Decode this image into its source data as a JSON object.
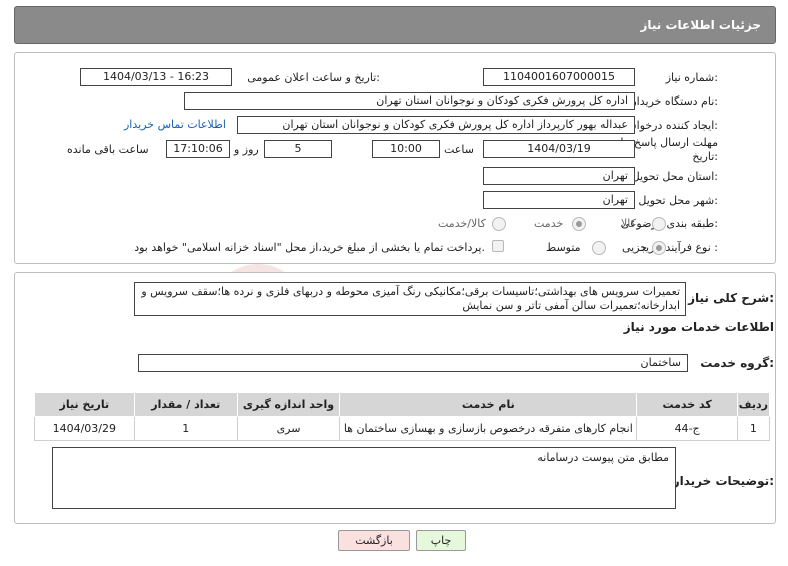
{
  "header": {
    "title": "جزئیات اطلاعات نیاز"
  },
  "form": {
    "need_number_label": "شماره نیاز:",
    "need_number": "1104001607000015",
    "announce_label": "تاریخ و ساعت اعلان عمومی:",
    "announce_value": "1404/03/13 - 16:23",
    "buyer_org_label": "نام دستگاه خریدار:",
    "buyer_org": "اداره کل پرورش فکری کودکان و نوجوانان استان تهران",
    "creator_label": "ایجاد کننده درخواست:",
    "creator": "عبداله بهور کارپرداز اداره کل پرورش فکری کودکان و نوجوانان استان تهران",
    "contact_link": "اطلاعات تماس خریدار",
    "deadline_label": "مهلت ارسال پاسخ: تا تاریخ:",
    "deadline_date": "1404/03/19",
    "hour_label": "ساعت",
    "deadline_time": "10:00",
    "days_value": "5",
    "days_label": "روز و",
    "remaining_time": "17:10:06",
    "remaining_label": "ساعت باقی مانده",
    "province_label": "استان محل تحویل:",
    "province": "تهران",
    "city_label": "شهر محل تحویل:",
    "city": "تهران",
    "category_label": "طبقه بندی موضوعی:",
    "category_options": [
      "کالا",
      "خدمت",
      "کالا/خدمت"
    ],
    "category_selected": "خدمت",
    "process_label": "نوع فرآیند خرید :",
    "process_options": [
      "جزیی",
      "متوسط"
    ],
    "process_selected": "جزیی",
    "payment_note": "پرداخت تمام یا بخشی از مبلغ خرید،از محل \"اسناد خزانه اسلامی\" خواهد بود."
  },
  "details": {
    "summary_label": "شرح کلی نیاز:",
    "summary": "تعمیرات سرویس های بهداشتی؛تاسیسات برقی؛مکانیکی رنگ آمیزی محوطه و دربهای فلزی و نرده ها؛سقف سرویس و ابدارخانه؛تعمیرات سالن آمفی تاتر و سن نمایش",
    "services_title": "اطلاعات خدمات مورد نیاز",
    "service_group_label": "گروه خدمت:",
    "service_group": "ساختمان",
    "table": {
      "headers": [
        "ردیف",
        "کد خدمت",
        "نام خدمت",
        "واحد اندازه گیری",
        "تعداد / مقدار",
        "تاریخ نیاز"
      ],
      "rows": [
        [
          "1",
          "ج-44",
          "انجام کارهای متفرقه درخصوص بازسازی و بهسازی ساختمان ها",
          "سری",
          "1",
          "1404/03/29"
        ]
      ]
    },
    "buyer_notes_label": "توضیحات خریدار:",
    "buyer_notes": "مطابق متن پیوست درسامانه"
  },
  "buttons": {
    "print": "چاپ",
    "back": "بازگشت"
  },
  "colors": {
    "header_bg": "#8a8a8a",
    "print_bg": "#e6f8dc",
    "back_bg": "#fbe0e0",
    "link": "#1a5fb4"
  }
}
